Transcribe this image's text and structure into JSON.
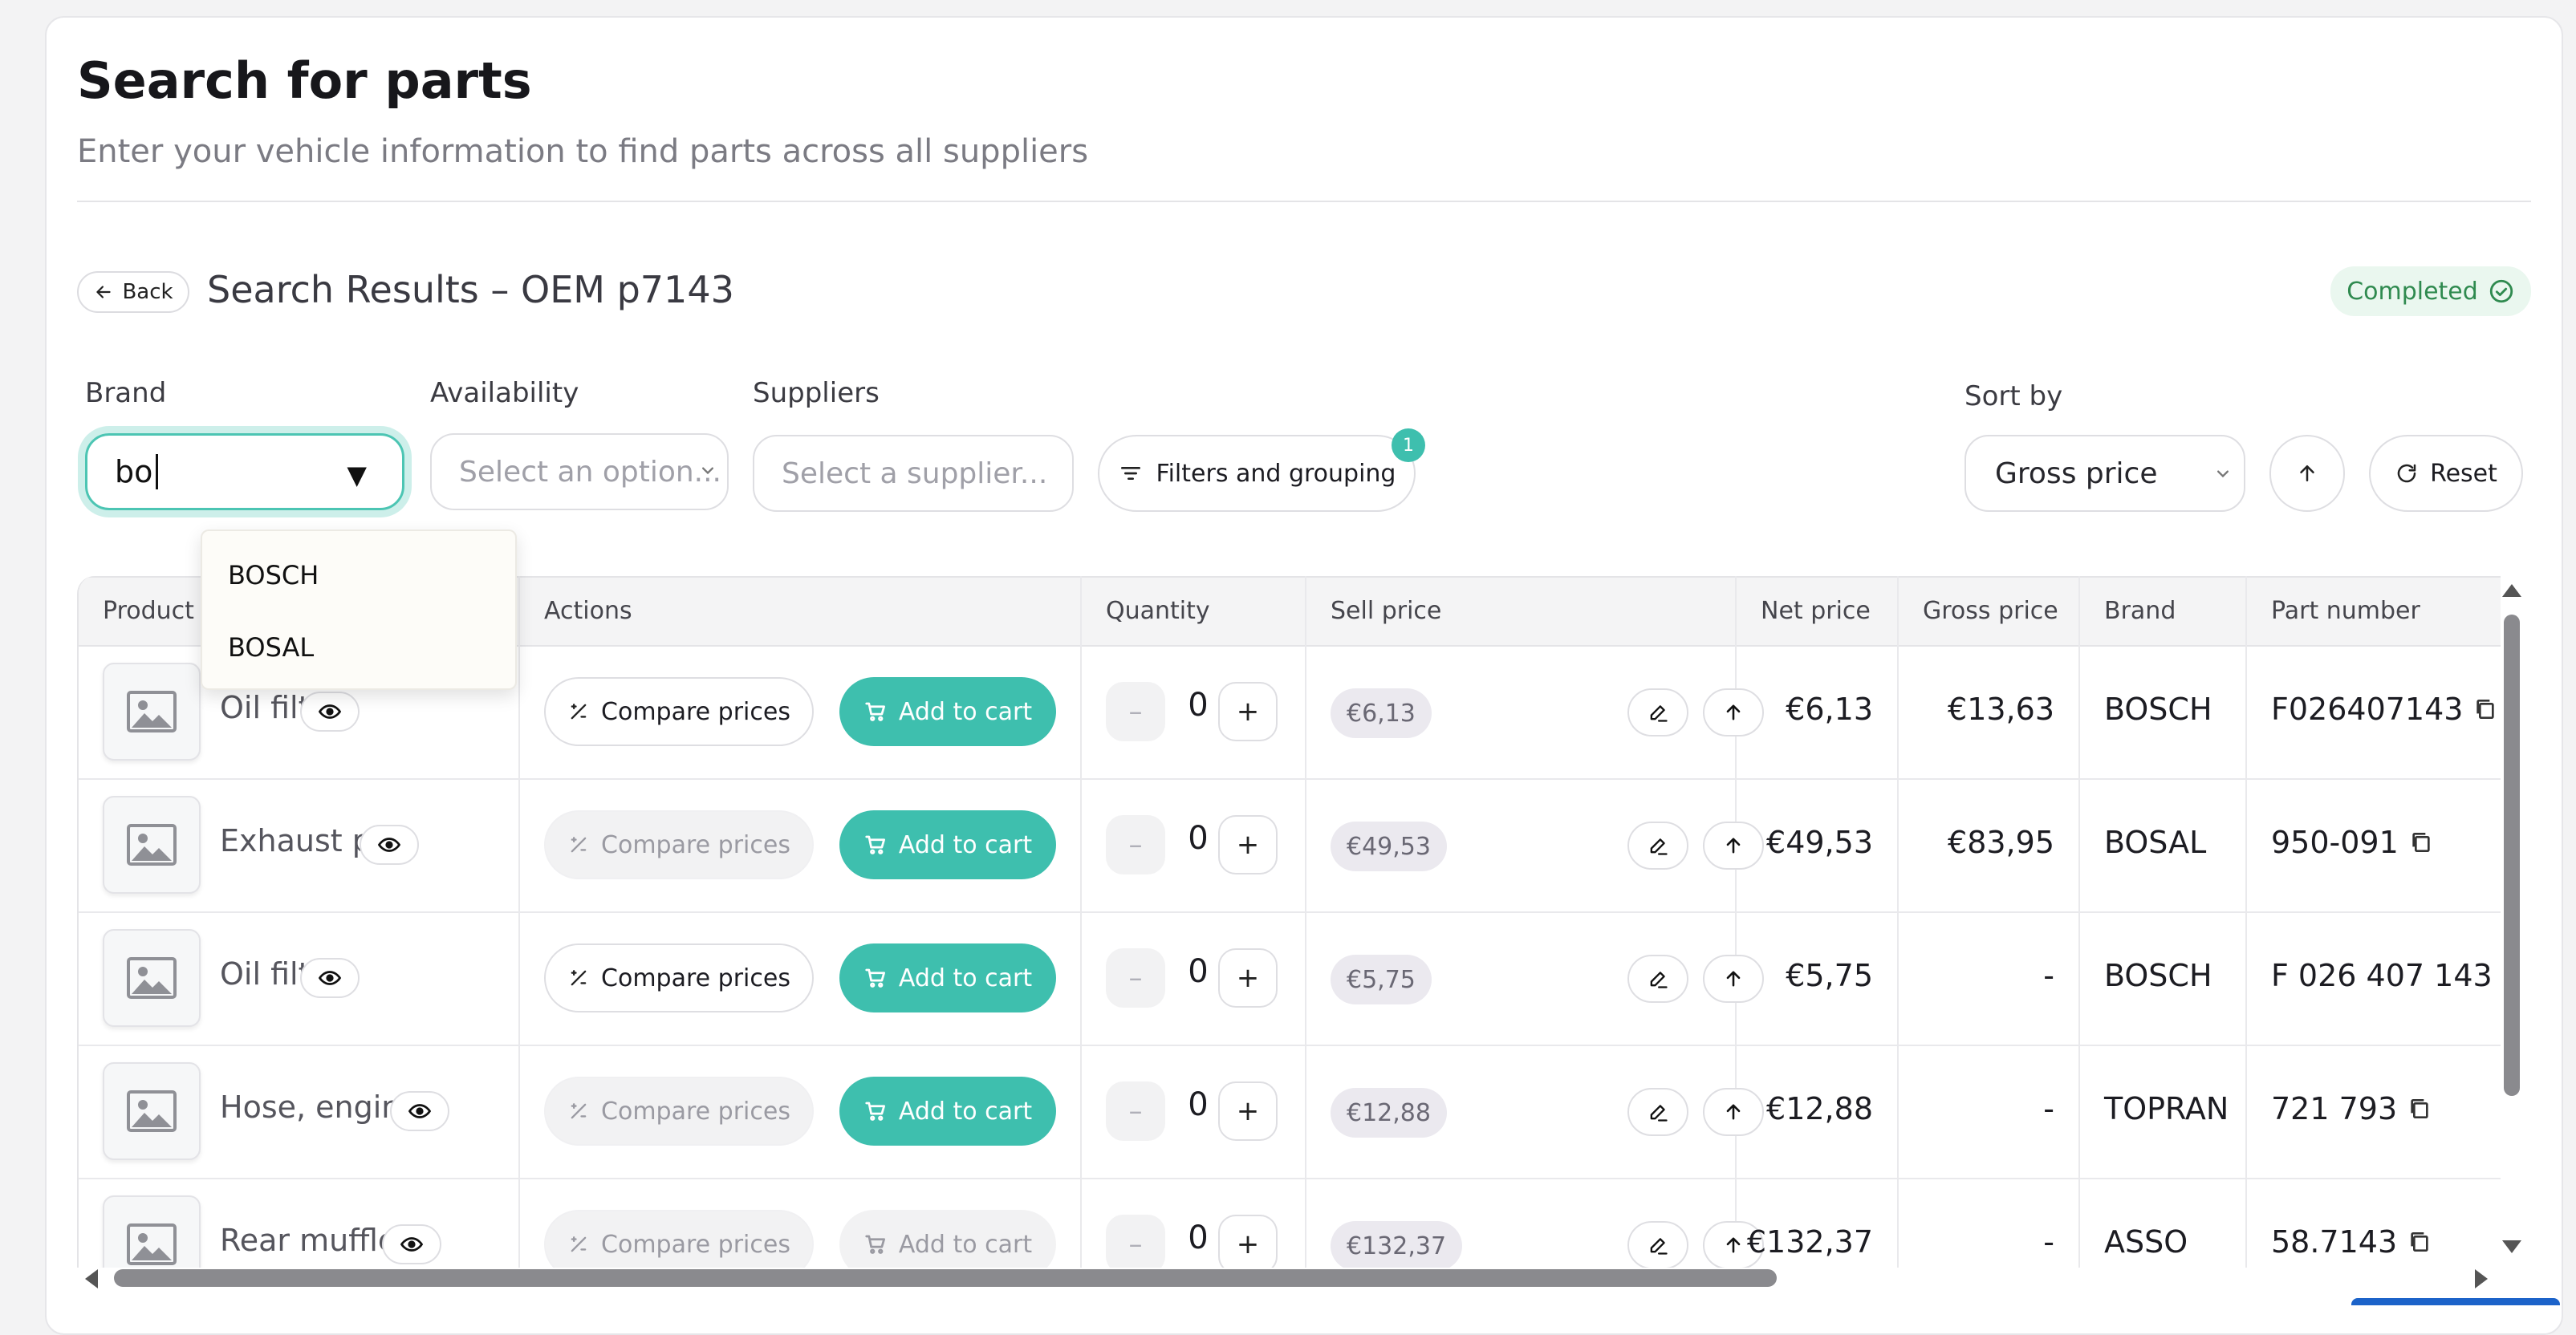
{
  "header": {
    "title": "Search for parts",
    "subtitle": "Enter your vehicle information to find parts across all suppliers"
  },
  "results": {
    "back_label": "Back",
    "title": "Search Results – OEM p7143",
    "status": "Completed"
  },
  "filters": {
    "brand_label": "Brand",
    "brand_value": "bo",
    "availability_label": "Availability",
    "availability_placeholder": "Select an option...",
    "suppliers_label": "Suppliers",
    "suppliers_placeholder": "Select a supplier...",
    "filters_button": "Filters and grouping",
    "filters_count": "1",
    "sort_label": "Sort by",
    "sort_value": "Gross price",
    "reset_label": "Reset"
  },
  "brand_dropdown": {
    "options": [
      "BOSCH",
      "BOSAL"
    ]
  },
  "table": {
    "columns": [
      "Product",
      "Actions",
      "Quantity",
      "Sell price",
      "Net price",
      "Gross price",
      "Brand",
      "Part number"
    ],
    "compare_label": "Compare prices",
    "add_to_cart_label": "Add to cart",
    "rows": [
      {
        "product": "Oil filter",
        "compare_enabled": true,
        "cart_enabled": true,
        "quantity": "0",
        "sell_price": "€6,13",
        "net_price": "€6,13",
        "gross_price": "€13,63",
        "brand": "BOSCH",
        "part_number": "F026407143"
      },
      {
        "product": "Exhaust pipe",
        "compare_enabled": false,
        "cart_enabled": true,
        "quantity": "0",
        "sell_price": "€49,53",
        "net_price": "€49,53",
        "gross_price": "€83,95",
        "brand": "BOSAL",
        "part_number": "950-091"
      },
      {
        "product": "Oil filter",
        "compare_enabled": true,
        "cart_enabled": true,
        "quantity": "0",
        "sell_price": "€5,75",
        "net_price": "€5,75",
        "gross_price": "-",
        "brand": "BOSCH",
        "part_number": "F 026 407 143"
      },
      {
        "product": "Hose, engine...",
        "compare_enabled": false,
        "cart_enabled": true,
        "quantity": "0",
        "sell_price": "€12,88",
        "net_price": "€12,88",
        "gross_price": "-",
        "brand": "TOPRAN",
        "part_number": "721 793"
      },
      {
        "product": "Rear muffler",
        "compare_enabled": false,
        "cart_enabled": false,
        "quantity": "0",
        "sell_price": "€132,37",
        "net_price": "€132,37",
        "gross_price": "-",
        "brand": "ASSO",
        "part_number": "58.7143"
      }
    ]
  },
  "colors": {
    "accent": "#3ebfae",
    "status_green": "#2f8a4f",
    "focus_ring": "#4cc5b3"
  },
  "icons": {
    "back": "arrow-left-icon",
    "status": "check-circle-icon",
    "filters": "filter-lines-icon",
    "sort_direction": "arrow-up-icon",
    "reset": "refresh-icon",
    "product_image": "image-placeholder-icon",
    "view": "eye-icon",
    "compare": "percent-icon",
    "cart": "cart-icon",
    "edit": "pencil-icon",
    "push": "arrow-up-icon",
    "copy": "copy-icon"
  }
}
